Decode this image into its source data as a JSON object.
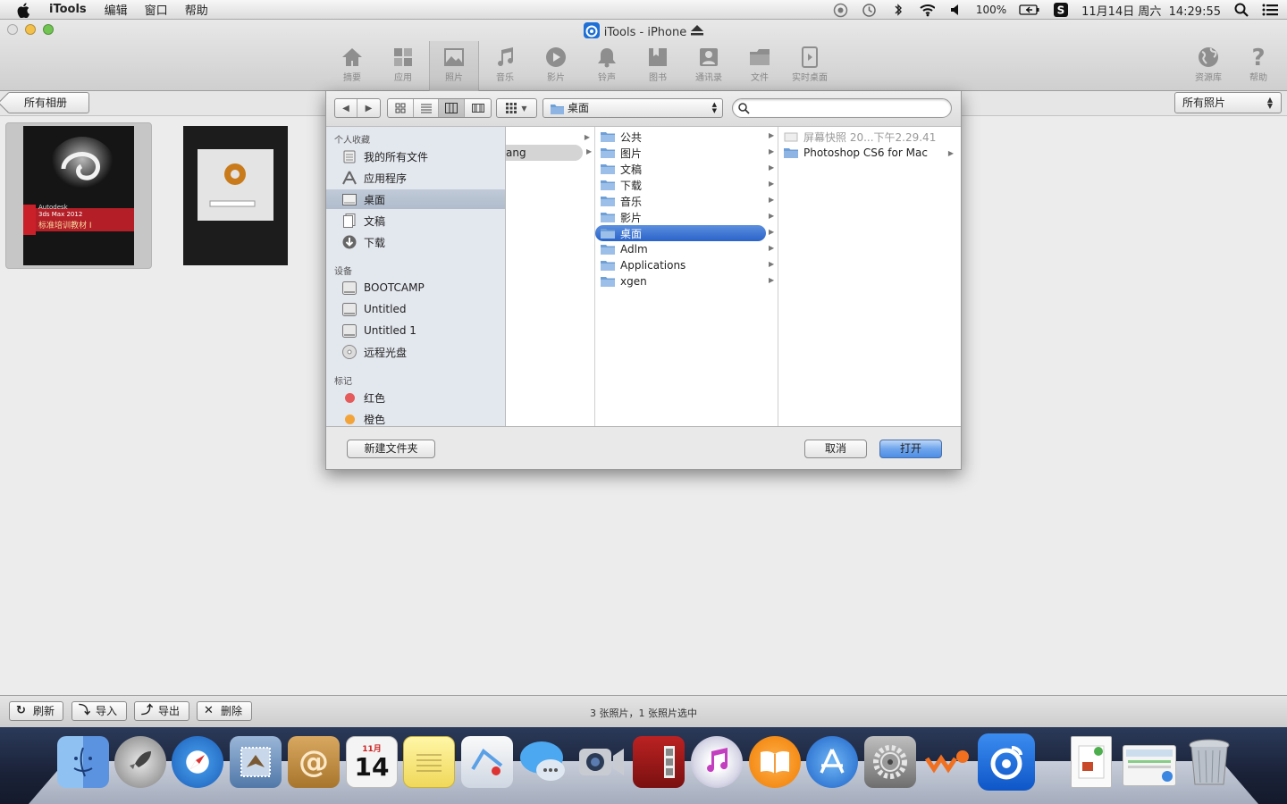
{
  "menubar": {
    "app": "iTools",
    "items": [
      "编辑",
      "窗口",
      "帮助"
    ],
    "battery": "100%",
    "datetime": "11月14日 周六  14:29:55"
  },
  "window": {
    "title": "iTools - iPhone"
  },
  "toolbar": {
    "buttons": [
      {
        "label": "摘要",
        "icon": "home-icon"
      },
      {
        "label": "应用",
        "icon": "apps-icon"
      },
      {
        "label": "照片",
        "icon": "photo-icon"
      },
      {
        "label": "音乐",
        "icon": "music-icon"
      },
      {
        "label": "影片",
        "icon": "play-icon"
      },
      {
        "label": "铃声",
        "icon": "bell-icon"
      },
      {
        "label": "图书",
        "icon": "book-icon"
      },
      {
        "label": "通讯录",
        "icon": "contacts-icon"
      },
      {
        "label": "文件",
        "icon": "folder-icon"
      },
      {
        "label": "实时桌面",
        "icon": "screen-icon"
      }
    ],
    "active": "照片",
    "right_buttons": [
      {
        "label": "资源库",
        "icon": "globe-icon"
      },
      {
        "label": "帮助",
        "icon": "question-icon"
      }
    ]
  },
  "subbar": {
    "back_label": "所有相册",
    "filter_label": "所有照片"
  },
  "thumbnails": [
    {
      "caption_lines": [
        "Autodesk",
        "3ds Max 2012",
        "标准培训教材 I"
      ],
      "selected": true
    },
    {
      "caption_lines": [],
      "selected": false
    }
  ],
  "dialog": {
    "path": "桌面",
    "search_placeholder": "",
    "sidebar": {
      "sections": [
        {
          "title": "个人收藏",
          "items": [
            {
              "label": "我的所有文件",
              "icon": "all-files-icon"
            },
            {
              "label": "应用程序",
              "icon": "applications-icon"
            },
            {
              "label": "桌面",
              "icon": "desktop-icon",
              "selected": true
            },
            {
              "label": "文稿",
              "icon": "documents-icon"
            },
            {
              "label": "下载",
              "icon": "downloads-icon"
            }
          ]
        },
        {
          "title": "设备",
          "items": [
            {
              "label": "BOOTCAMP",
              "icon": "disk-icon"
            },
            {
              "label": "Untitled",
              "icon": "disk-icon"
            },
            {
              "label": "Untitled 1",
              "icon": "disk-icon"
            },
            {
              "label": "远程光盘",
              "icon": "optical-disc-icon"
            }
          ]
        },
        {
          "title": "标记",
          "items": [
            {
              "label": "红色",
              "color": "#e55a5a"
            },
            {
              "label": "橙色",
              "color": "#f2a43a"
            }
          ]
        }
      ]
    },
    "column1": [
      {
        "label": "",
        "chevron": true
      },
      {
        "label": "ang",
        "chevron": true,
        "selected_gray": true
      }
    ],
    "column2": [
      {
        "label": "公共"
      },
      {
        "label": "图片"
      },
      {
        "label": "文稿"
      },
      {
        "label": "下载"
      },
      {
        "label": "音乐"
      },
      {
        "label": "影片"
      },
      {
        "label": "桌面",
        "selected": true
      },
      {
        "label": "Adlm"
      },
      {
        "label": "Applications"
      },
      {
        "label": "xgen"
      }
    ],
    "column3": [
      {
        "label": "屏幕快照 20...下午2.29.41",
        "gray": true
      },
      {
        "label": "Photoshop CS6 for Mac",
        "chevron": true
      }
    ],
    "new_folder": "新建文件夹",
    "cancel": "取消",
    "open": "打开"
  },
  "statusbar": {
    "buttons": [
      {
        "label": "刷新",
        "icon": "refresh-icon"
      },
      {
        "label": "导入",
        "icon": "import-icon"
      },
      {
        "label": "导出",
        "icon": "export-icon"
      },
      {
        "label": "删除",
        "icon": "delete-icon"
      }
    ],
    "text": "3 张照片，1 张照片选中"
  },
  "dock": {
    "calendar_month": "11月",
    "calendar_day": "14"
  },
  "colors": {
    "accent": "#2a63c9",
    "sidebar_bg": "#e3e7ee"
  }
}
